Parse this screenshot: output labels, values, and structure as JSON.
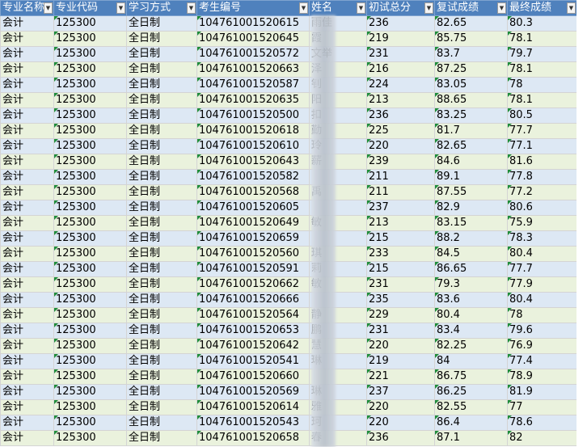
{
  "colors": {
    "header_bg": "#4f81bd",
    "band_odd": "#dde8f4",
    "band_even": "#eaf2dd",
    "error_mark": "#1e8c3a"
  },
  "headers": [
    "专业名称",
    "专业代码",
    "学习方式",
    "考生编号",
    "姓名",
    "初试总分",
    "复试成绩",
    "最终成绩"
  ],
  "filter_icon": "filter-dropdown-icon",
  "rows": [
    [
      "会计",
      "125300",
      "全日制",
      "104761001520615",
      "雨佳",
      "236",
      "82.65",
      "80.3"
    ],
    [
      "会计",
      "125300",
      "全日制",
      "104761001520645",
      "霞",
      "219",
      "85.75",
      "78.1"
    ],
    [
      "会计",
      "125300",
      "全日制",
      "104761001520572",
      "文举",
      "231",
      "83.7",
      "79.7"
    ],
    [
      "会计",
      "125300",
      "全日制",
      "104761001520663",
      "泽",
      "216",
      "87.25",
      "78.1"
    ],
    [
      "会计",
      "125300",
      "全日制",
      "104761001520587",
      "钊",
      "224",
      "83.05",
      "78"
    ],
    [
      "会计",
      "125300",
      "全日制",
      "104761001520635",
      "阳",
      "213",
      "88.65",
      "78.1"
    ],
    [
      "会计",
      "125300",
      "全日制",
      "104761001520500",
      "扣",
      "236",
      "83.25",
      "80.5"
    ],
    [
      "会计",
      "125300",
      "全日制",
      "104761001520618",
      "勤",
      "225",
      "81.7",
      "77.7"
    ],
    [
      "会计",
      "125300",
      "全日制",
      "104761001520610",
      "玲",
      "220",
      "82.65",
      "77.1"
    ],
    [
      "会计",
      "125300",
      "全日制",
      "104761001520643",
      "薪",
      "239",
      "84.6",
      "81.6"
    ],
    [
      "会计",
      "125300",
      "全日制",
      "104761001520582",
      "",
      "211",
      "89.1",
      "77.8"
    ],
    [
      "会计",
      "125300",
      "全日制",
      "104761001520568",
      "禹",
      "211",
      "87.55",
      "77.2"
    ],
    [
      "会计",
      "125300",
      "全日制",
      "104761001520605",
      "",
      "237",
      "82.9",
      "80.6"
    ],
    [
      "会计",
      "125300",
      "全日制",
      "104761001520649",
      "敏",
      "213",
      "83.15",
      "75.9"
    ],
    [
      "会计",
      "125300",
      "全日制",
      "104761001520659",
      "",
      "215",
      "88.2",
      "78.3"
    ],
    [
      "会计",
      "125300",
      "全日制",
      "104761001520560",
      "琪",
      "233",
      "84.5",
      "80.4"
    ],
    [
      "会计",
      "125300",
      "全日制",
      "104761001520591",
      "莉",
      "215",
      "86.65",
      "77.7"
    ],
    [
      "会计",
      "125300",
      "全日制",
      "104761001520662",
      "敏",
      "231",
      "79.3",
      "77.9"
    ],
    [
      "会计",
      "125300",
      "全日制",
      "104761001520666",
      "",
      "235",
      "83.6",
      "80.4"
    ],
    [
      "会计",
      "125300",
      "全日制",
      "104761001520564",
      "静",
      "229",
      "80.4",
      "78"
    ],
    [
      "会计",
      "125300",
      "全日制",
      "104761001520653",
      "鹏",
      "231",
      "83.4",
      "79.6"
    ],
    [
      "会计",
      "125300",
      "全日制",
      "104761001520642",
      "慧",
      "220",
      "82.25",
      "76.9"
    ],
    [
      "会计",
      "125300",
      "全日制",
      "104761001520541",
      "琳",
      "219",
      "84",
      "77.4"
    ],
    [
      "会计",
      "125300",
      "全日制",
      "104761001520660",
      "",
      "221",
      "86.75",
      "78.9"
    ],
    [
      "会计",
      "125300",
      "全日制",
      "104761001520569",
      "琳",
      "237",
      "86.25",
      "81.9"
    ],
    [
      "会计",
      "125300",
      "全日制",
      "104761001520614",
      "雅",
      "220",
      "82.55",
      "77"
    ],
    [
      "会计",
      "125300",
      "全日制",
      "104761001520543",
      "珂",
      "220",
      "86.4",
      "78.6"
    ],
    [
      "会计",
      "125300",
      "全日制",
      "104761001520658",
      "春",
      "236",
      "87.1",
      "82"
    ]
  ]
}
